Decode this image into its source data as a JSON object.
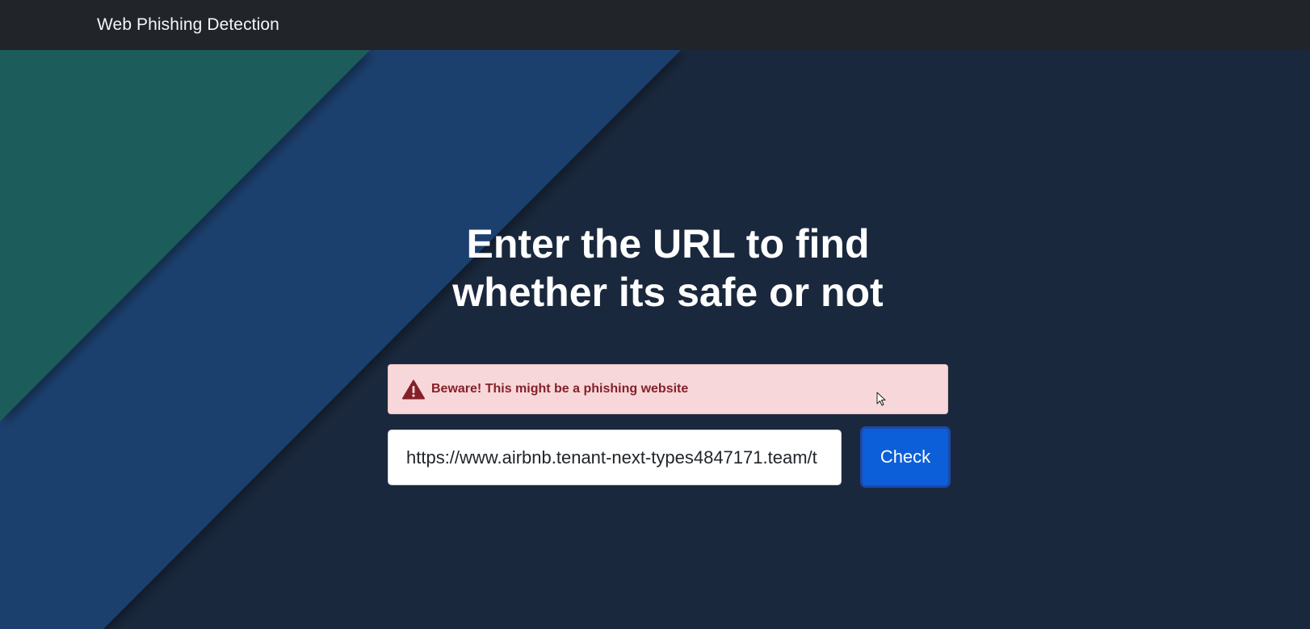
{
  "navbar": {
    "brand": "Web Phishing Detection"
  },
  "hero": {
    "headline_line1": "Enter the URL to find",
    "headline_line2": "whether its safe or not"
  },
  "alert": {
    "icon": "exclamation-triangle-icon",
    "message": "Beware! This might be a phishing website"
  },
  "form": {
    "url_value": "https://www.airbnb.tenant-next-types4847171.team/t",
    "check_label": "Check"
  },
  "colors": {
    "navbar_bg": "#212429",
    "page_bg": "#1a283d",
    "stripe_teal": "#1f5c5a",
    "stripe_blue": "#1d3f6e",
    "alert_bg": "#f8d7da",
    "alert_text": "#842029",
    "button_bg": "#0d5fd9"
  }
}
